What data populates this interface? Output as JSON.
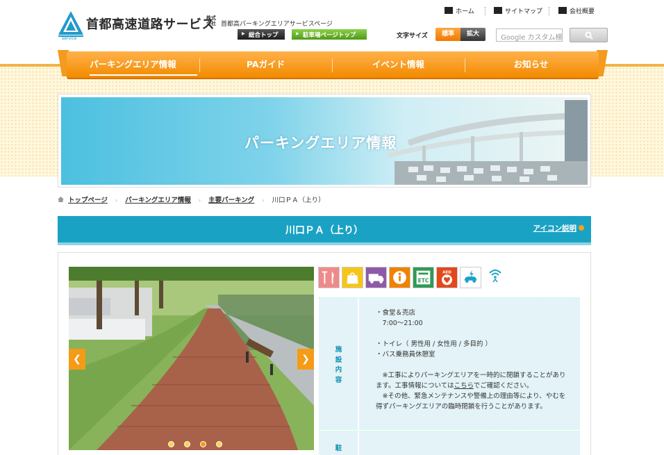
{
  "header": {
    "logo_text": "首都高速道路サービス",
    "logo_kaisha": "株式会社",
    "logo_service": "service",
    "site_subtitle": "首都高パーキングエリアサービスページ",
    "btn_general_top": "総合トップ",
    "btn_parking_top": "駐車場ページトップ",
    "util_home": "ホーム",
    "util_sitemap": "サイトマップ",
    "util_company": "会社概要",
    "font_size_label": "文字サイズ",
    "font_standard": "標準",
    "font_large": "拡大",
    "search_placeholder": "Google カスタム検索"
  },
  "nav": {
    "items": [
      {
        "label": "パーキングエリア情報"
      },
      {
        "label": "PAガイド"
      },
      {
        "label": "イベント情報"
      },
      {
        "label": "お知らせ"
      }
    ]
  },
  "hero": {
    "title": "パーキングエリア情報"
  },
  "breadcrumb": {
    "items": [
      {
        "label": "トップページ"
      },
      {
        "label": "パーキングエリア情報"
      },
      {
        "label": "主要パーキング"
      }
    ],
    "current": "川口ＰＡ（上り）"
  },
  "page": {
    "title": "川口ＰＡ（上り）",
    "icon_legend": "アイコン説明"
  },
  "facility_icons": [
    "restaurant-icon",
    "shop-icon",
    "truck-icon",
    "information-icon",
    "etc-icon",
    "aed-icon",
    "ev-charger-icon",
    "wifi-icon"
  ],
  "colors": {
    "accent": "#f28a00",
    "teal": "#1aa2c5",
    "light_teal": "#e3f3f7"
  },
  "info": {
    "row1_head": "施設内容",
    "row1_body": "・食堂＆売店\n　7:00～21:00\n\n・トイレ（ 男性用 / 女性用 / 多目的 ）\n・バス乗務員休憩室\n\n　※工事によりパーキングエリアを一時的に閉鎖することがあります。工事情報については",
    "row1_link": "こちら",
    "row1_after": "でご確認ください。\n　※その他、緊急メンテナンスや警備上の理由等により、やむを得ずパーキングエリアの臨時閉鎖を行うことがあります。",
    "row2_head": "駐"
  }
}
